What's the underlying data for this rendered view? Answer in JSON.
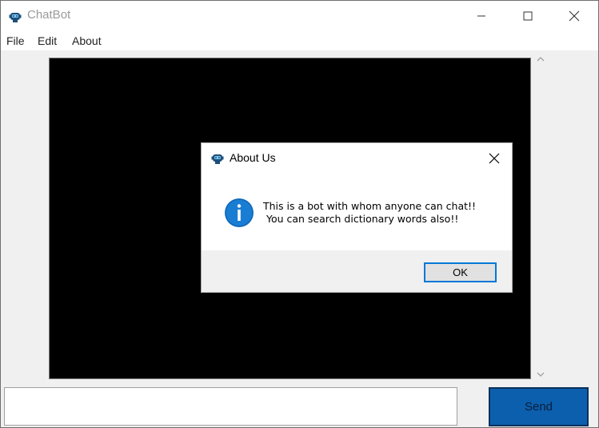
{
  "window": {
    "title": "ChatBot",
    "icon": "robot-icon"
  },
  "menu": {
    "items": [
      {
        "label": "File"
      },
      {
        "label": "Edit"
      },
      {
        "label": "About"
      }
    ]
  },
  "chat": {
    "background": "#000000",
    "input_value": "",
    "send_label": "Send",
    "send_color": "#0b5fad"
  },
  "dialog": {
    "title": "About Us",
    "icon": "info-icon",
    "message_line1": "This is a bot with whom anyone can chat!!",
    "message_line2": " You can search dictionary words also!!",
    "ok_label": "OK"
  }
}
